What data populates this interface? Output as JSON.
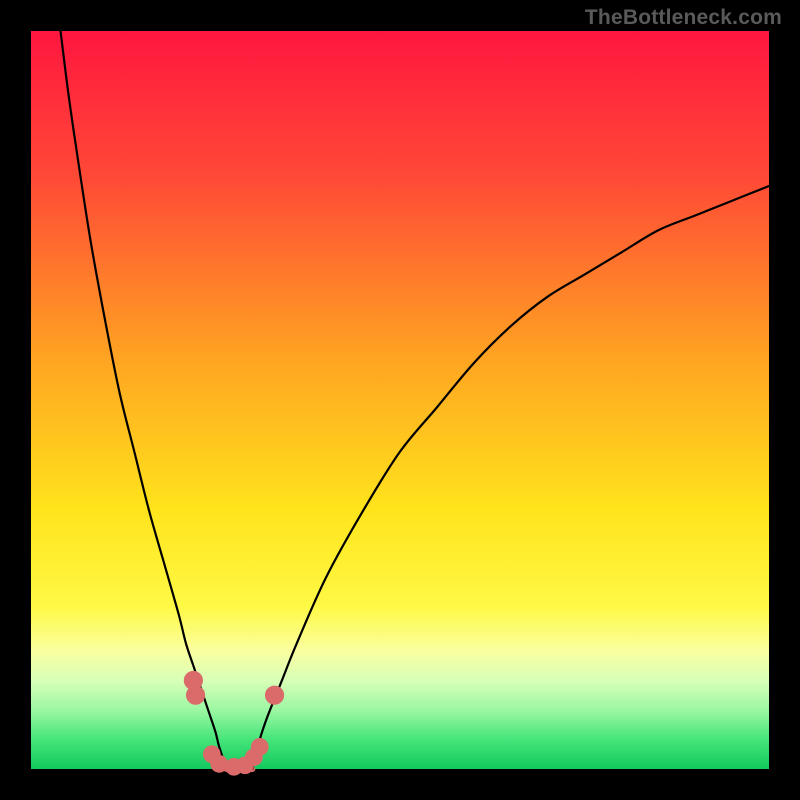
{
  "watermark": {
    "text": "TheBottleneck.com"
  },
  "chart_data": {
    "type": "line",
    "title": "",
    "xlabel": "",
    "ylabel": "",
    "x_range": [
      0,
      100
    ],
    "y_range": [
      0,
      100
    ],
    "grid": false,
    "legend": false,
    "annotations": [],
    "background_gradient": {
      "stops": [
        {
          "pct": 0,
          "color": "#ff163f"
        },
        {
          "pct": 20,
          "color": "#ff4a36"
        },
        {
          "pct": 45,
          "color": "#ffa621"
        },
        {
          "pct": 65,
          "color": "#ffe41c"
        },
        {
          "pct": 78,
          "color": "#fff945"
        },
        {
          "pct": 84,
          "color": "#faffa0"
        },
        {
          "pct": 88,
          "color": "#d8ffb8"
        },
        {
          "pct": 92,
          "color": "#9cf7a3"
        },
        {
          "pct": 96,
          "color": "#45e57a"
        },
        {
          "pct": 100,
          "color": "#12c95e"
        }
      ]
    },
    "series": [
      {
        "name": "left-branch",
        "x": [
          4,
          5,
          6,
          8,
          10,
          12,
          14,
          16,
          18,
          20,
          21,
          22,
          23,
          24,
          25,
          25.5,
          26.5
        ],
        "y": [
          100,
          92,
          85,
          72,
          61,
          51,
          43,
          35,
          28,
          21,
          17,
          14,
          11,
          8,
          5,
          3,
          0
        ],
        "stroke": "#000000",
        "width": 2.2
      },
      {
        "name": "right-branch",
        "x": [
          30,
          31,
          32,
          34,
          36,
          40,
          45,
          50,
          55,
          60,
          65,
          70,
          75,
          80,
          85,
          90,
          95,
          100
        ],
        "y": [
          0,
          4,
          7,
          12,
          17,
          26,
          35,
          43,
          49,
          55,
          60,
          64,
          67,
          70,
          73,
          75,
          77,
          79
        ],
        "stroke": "#000000",
        "width": 2.2
      }
    ],
    "markers": [
      {
        "x": 22.0,
        "y": 12.0,
        "r": 1.3,
        "color": "#db6a6a"
      },
      {
        "x": 22.3,
        "y": 10.0,
        "r": 1.3,
        "color": "#db6a6a"
      },
      {
        "x": 24.5,
        "y": 2.0,
        "r": 1.2,
        "color": "#db6a6a"
      },
      {
        "x": 25.5,
        "y": 0.7,
        "r": 1.2,
        "color": "#db6a6a"
      },
      {
        "x": 27.5,
        "y": 0.3,
        "r": 1.2,
        "color": "#db6a6a"
      },
      {
        "x": 29.0,
        "y": 0.5,
        "r": 1.2,
        "color": "#db6a6a"
      },
      {
        "x": 30.2,
        "y": 1.6,
        "r": 1.2,
        "color": "#db6a6a"
      },
      {
        "x": 31.0,
        "y": 3.0,
        "r": 1.2,
        "color": "#db6a6a"
      },
      {
        "x": 33.0,
        "y": 10.0,
        "r": 1.3,
        "color": "#db6a6a"
      }
    ],
    "flat_segment": {
      "x": [
        26.5,
        30.0
      ],
      "y": [
        0,
        0
      ],
      "stroke": "#db6a6a",
      "width": 6
    }
  }
}
